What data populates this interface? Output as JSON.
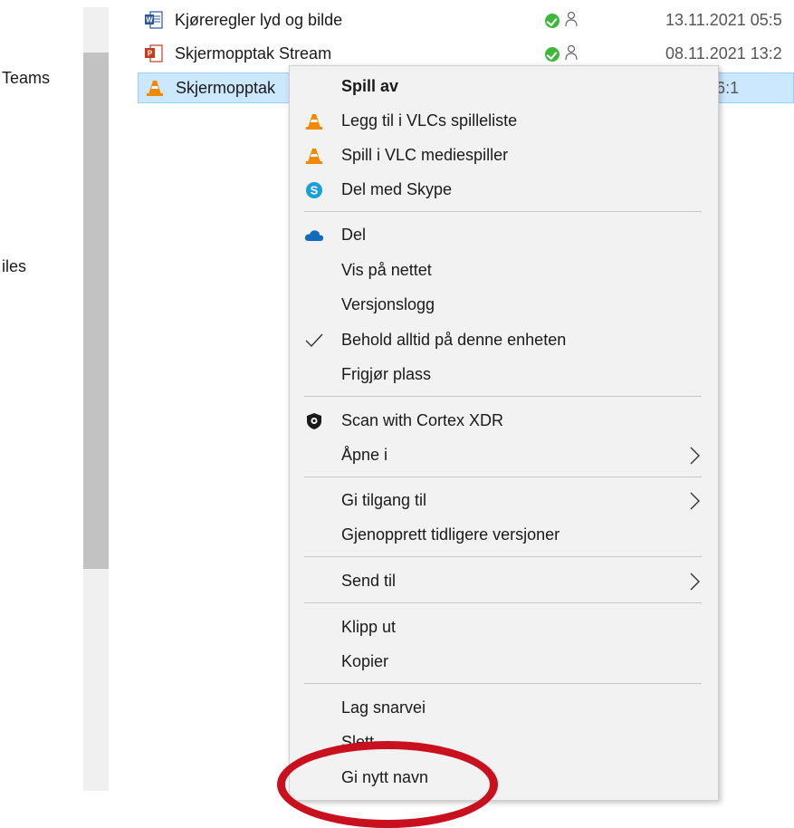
{
  "nav": {
    "items": [
      {
        "label": "Teams"
      },
      {
        "label": "iles"
      }
    ]
  },
  "files": [
    {
      "name": "Kjøreregler lyd og bilde",
      "date": "13.11.2021 05:5",
      "icon": "word-doc-icon"
    },
    {
      "name": "Skjermopptak Stream",
      "date": "08.11.2021 13:2",
      "icon": "powerpoint-icon"
    },
    {
      "name": "Skjermopptak",
      "date": "2021 06:1",
      "icon": "vlc-cone-icon"
    }
  ],
  "context_menu": {
    "items": [
      {
        "label": "Spill av",
        "icon": "",
        "bold": true
      },
      {
        "label": "Legg til i VLCs spilleliste",
        "icon": "vlc-cone-icon"
      },
      {
        "label": "Spill i VLC mediespiller",
        "icon": "vlc-cone-icon"
      },
      {
        "label": "Del med Skype",
        "icon": "skype-icon"
      },
      {
        "label": "Del",
        "icon": "onedrive-cloud-icon"
      },
      {
        "label": "Vis på nettet",
        "icon": ""
      },
      {
        "label": "Versjonslogg",
        "icon": ""
      },
      {
        "label": "Behold alltid på denne enheten",
        "icon": "checkmark-icon"
      },
      {
        "label": "Frigjør plass",
        "icon": ""
      },
      {
        "label": "Scan with Cortex XDR",
        "icon": "shield-icon"
      },
      {
        "label": "Åpne i",
        "icon": "",
        "submenu": true
      },
      {
        "label": "Gi tilgang til",
        "icon": "",
        "submenu": true
      },
      {
        "label": "Gjenopprett tidligere versjoner",
        "icon": ""
      },
      {
        "label": "Send til",
        "icon": "",
        "submenu": true
      },
      {
        "label": "Klipp ut",
        "icon": ""
      },
      {
        "label": "Kopier",
        "icon": ""
      },
      {
        "label": "Lag snarvei",
        "icon": ""
      },
      {
        "label": "Slett",
        "icon": ""
      },
      {
        "label": "Gi nytt navn",
        "icon": ""
      }
    ]
  },
  "colors": {
    "selection_bg": "#cce8ff",
    "menu_bg": "#f2f2f2",
    "annotation": "#c8101e",
    "sync_ok": "#3db83a"
  }
}
